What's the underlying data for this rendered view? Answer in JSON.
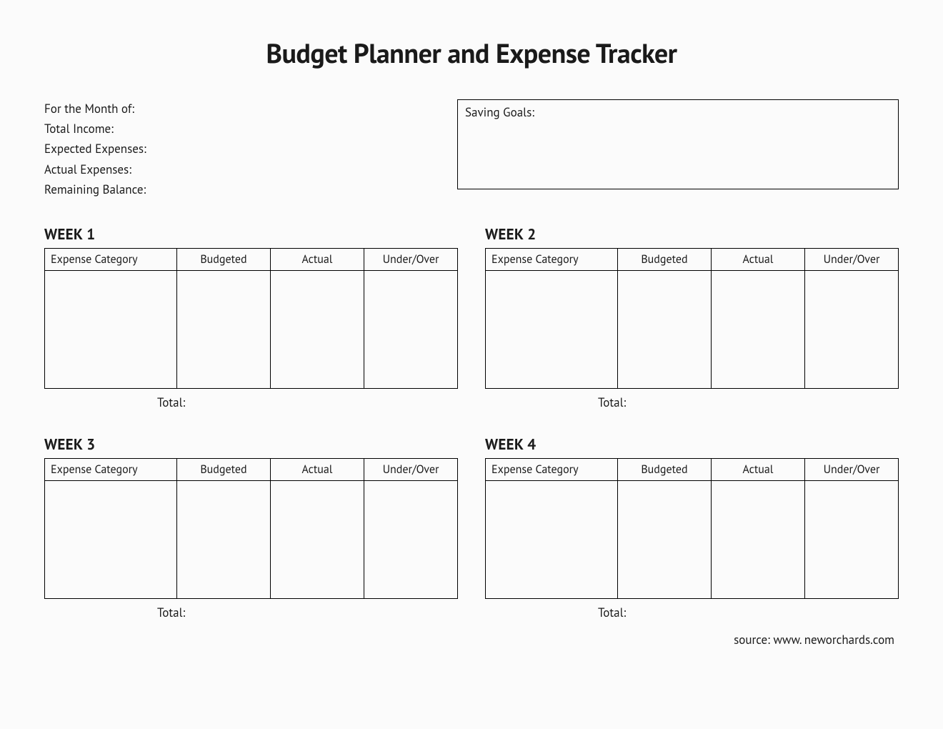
{
  "title": "Budget Planner and Expense Tracker",
  "summary": {
    "month_label": "For the Month of:",
    "income_label": "Total Income:",
    "expected_label": "Expected Expenses:",
    "actual_label": "Actual Expenses:",
    "remaining_label": "Remaining Balance:"
  },
  "saving_goals_label": "Saving Goals:",
  "table_headers": {
    "category": "Expense Category",
    "budgeted": "Budgeted",
    "actual": "Actual",
    "under_over": "Under/Over"
  },
  "weeks": [
    {
      "title": "WEEK 1",
      "total_label": "Total:"
    },
    {
      "title": "WEEK 2",
      "total_label": "Total:"
    },
    {
      "title": "WEEK 3",
      "total_label": "Total:"
    },
    {
      "title": "WEEK 4",
      "total_label": "Total:"
    }
  ],
  "source": "source: www. neworchards.com"
}
